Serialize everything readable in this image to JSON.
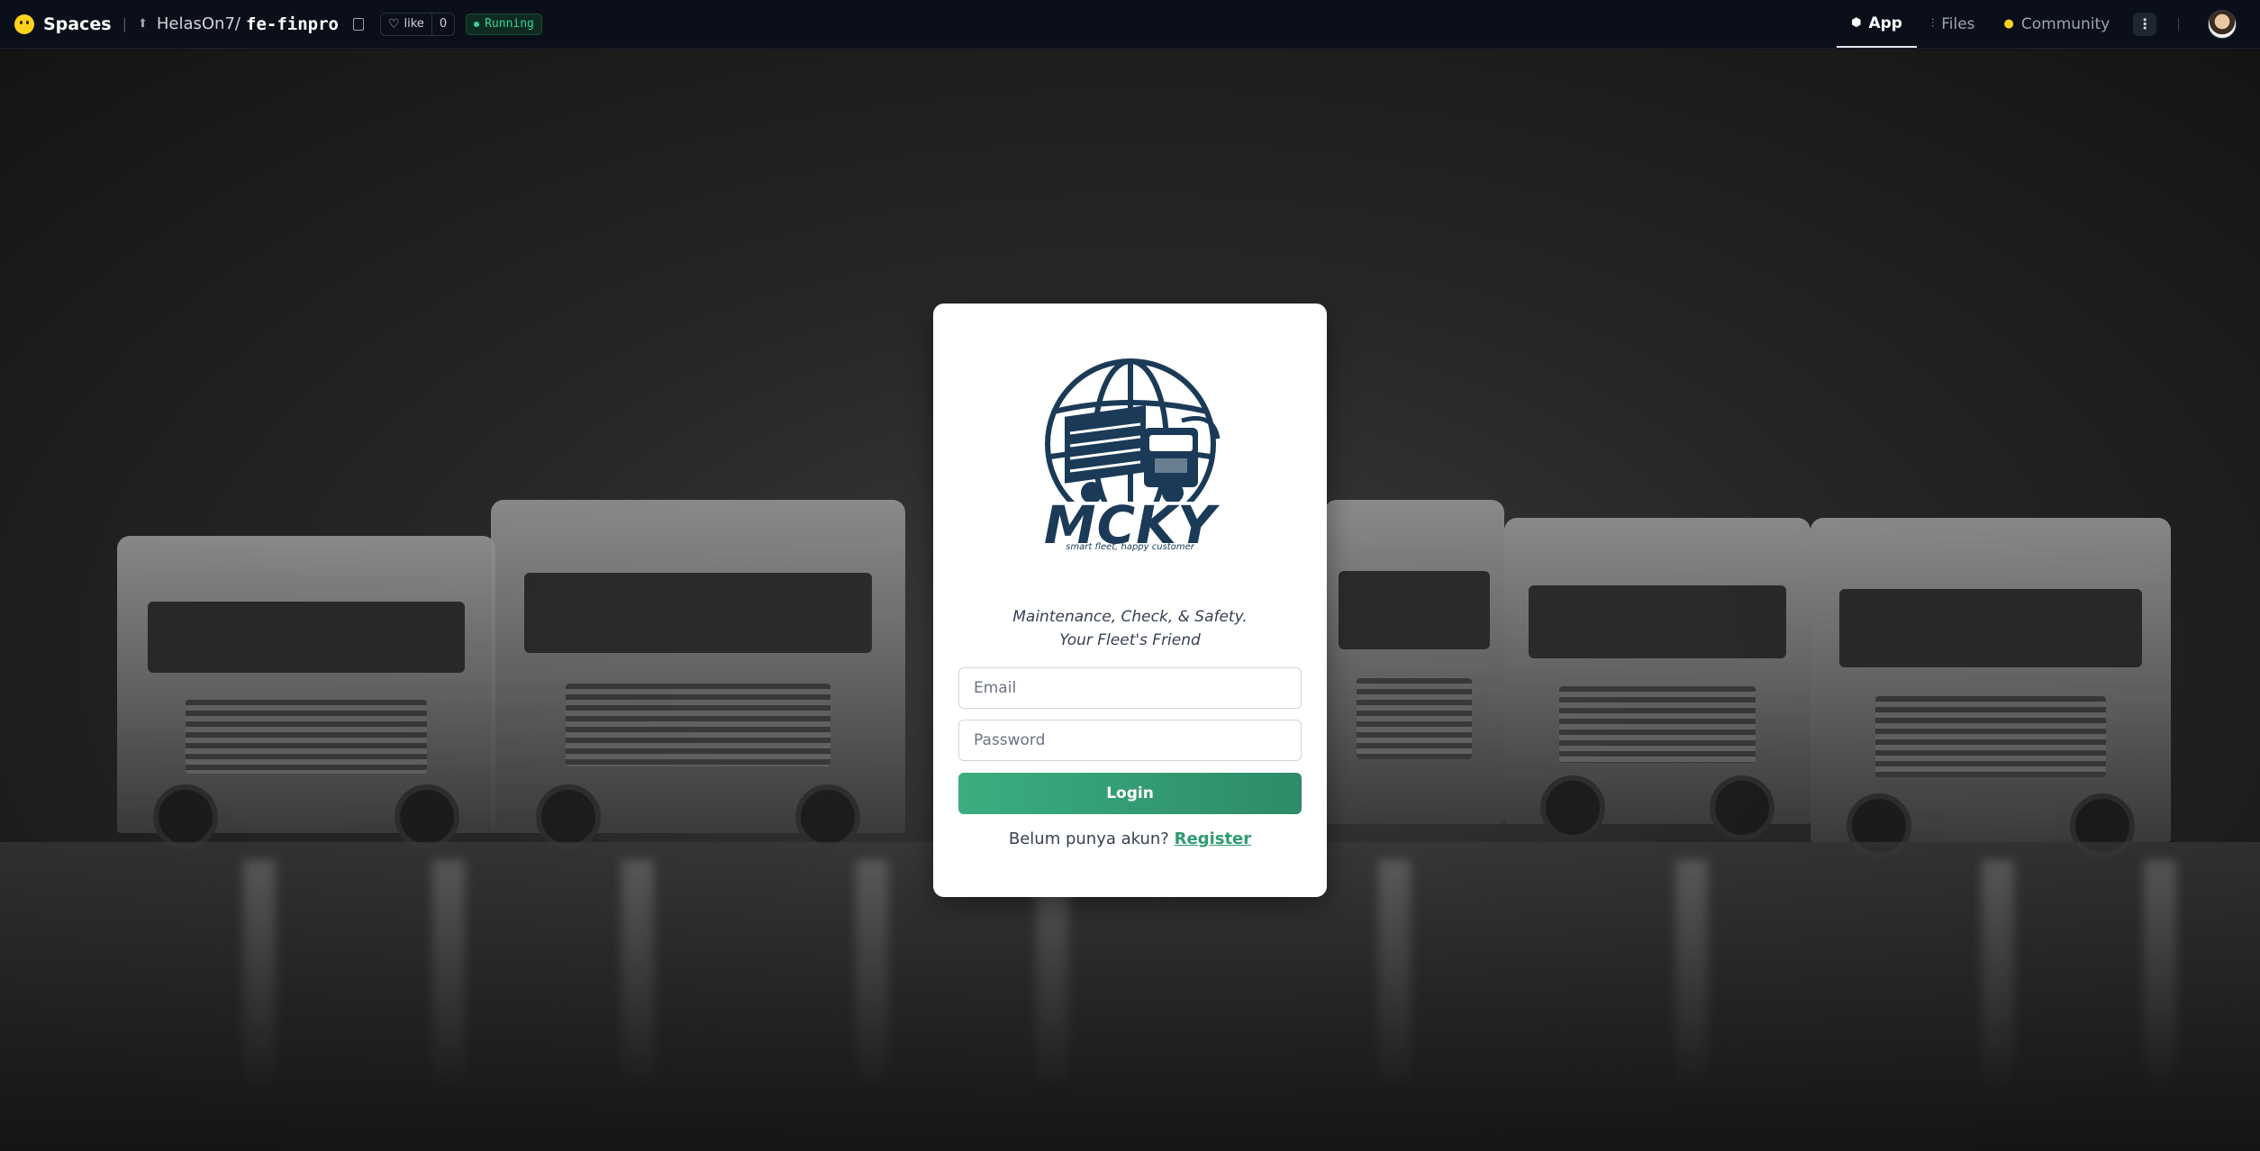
{
  "header": {
    "spaces_label": "Spaces",
    "owner": "HelasOn7/",
    "repo_name": "fe-finpro",
    "like_label": "like",
    "like_count": "0",
    "status": "Running",
    "tabs": [
      {
        "label": "App",
        "icon": "app-icon",
        "active": true
      },
      {
        "label": "Files",
        "icon": "files-icon",
        "active": false
      },
      {
        "label": "Community",
        "icon": "community-icon",
        "active": false
      }
    ],
    "more_label": "⋮"
  },
  "login": {
    "brand_name": "MCKY",
    "brand_slogan": "smart fleet, happy customer",
    "tagline_line1": "Maintenance, Check, & Safety.",
    "tagline_line2": "Your Fleet's Friend",
    "email_placeholder": "Email",
    "password_placeholder": "Password",
    "login_button": "Login",
    "register_prompt": "Belum punya akun?",
    "register_link": "Register"
  },
  "colors": {
    "accent": "#3aae80",
    "logo_navy": "#1b3a57",
    "header_bg": "#0b0f19"
  }
}
